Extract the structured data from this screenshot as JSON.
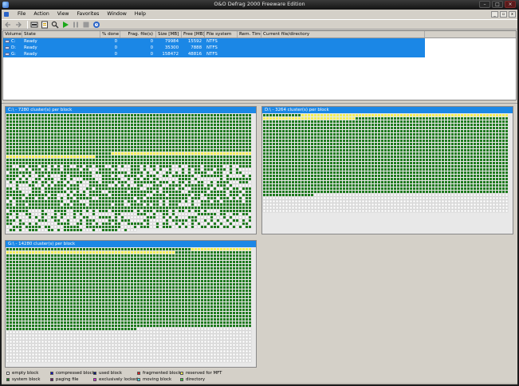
{
  "window": {
    "title": "O&O Defrag 2000 Freeware Edition"
  },
  "menu": [
    "File",
    "Action",
    "View",
    "Favorites",
    "Window",
    "Help"
  ],
  "toolbar": [
    "back-icon",
    "forward-icon",
    "drive-properties-icon",
    "report-icon",
    "zoom-icon",
    "start-icon",
    "pause-icon",
    "stop-icon",
    "scheduler-icon"
  ],
  "volume_table": {
    "columns": [
      "Volume",
      "State",
      "% done",
      "Frag. file(s)",
      "Size [MB]",
      "Free [MB]",
      "File system",
      "Rem. Time",
      "Current file/directory"
    ],
    "rows": [
      {
        "volume": "C:",
        "state": "Ready",
        "done": "0",
        "frag": "0",
        "size": "79984",
        "free": "15592",
        "fs": "NTFS",
        "rem": "",
        "current": ""
      },
      {
        "volume": "D:",
        "state": "Ready",
        "done": "0",
        "frag": "0",
        "size": "35300",
        "free": "7888",
        "fs": "NTFS",
        "rem": "",
        "current": ""
      },
      {
        "volume": "G:",
        "state": "Ready",
        "done": "0",
        "frag": "0",
        "size": "158472",
        "free": "48816",
        "fs": "NTFS",
        "rem": "",
        "current": ""
      }
    ]
  },
  "maps": {
    "c": {
      "title": "C:\\ - 7280 cluster(s) per block"
    },
    "d": {
      "title": "D:\\ - 3264 cluster(s) per block"
    },
    "g": {
      "title": "G:\\ - 14280 cluster(s) per block"
    }
  },
  "legend": [
    {
      "label": "empty block",
      "color": "#ffffff"
    },
    {
      "label": "compressed block",
      "color": "#1010c0"
    },
    {
      "label": "used block",
      "color": "#0a1a7a"
    },
    {
      "label": "fragmented block",
      "color": "#e02020"
    },
    {
      "label": "reserved for MFT",
      "color": "#f2ef55"
    },
    {
      "label": "system block",
      "color": "#1f7a1f"
    },
    {
      "label": "paging file",
      "color": "#6a1a6a"
    },
    {
      "label": "exclusively locked",
      "color": "#e020e0"
    },
    {
      "label": "moving block",
      "color": "#40d8e0"
    },
    {
      "label": "directory",
      "color": "#3ad23a"
    }
  ]
}
